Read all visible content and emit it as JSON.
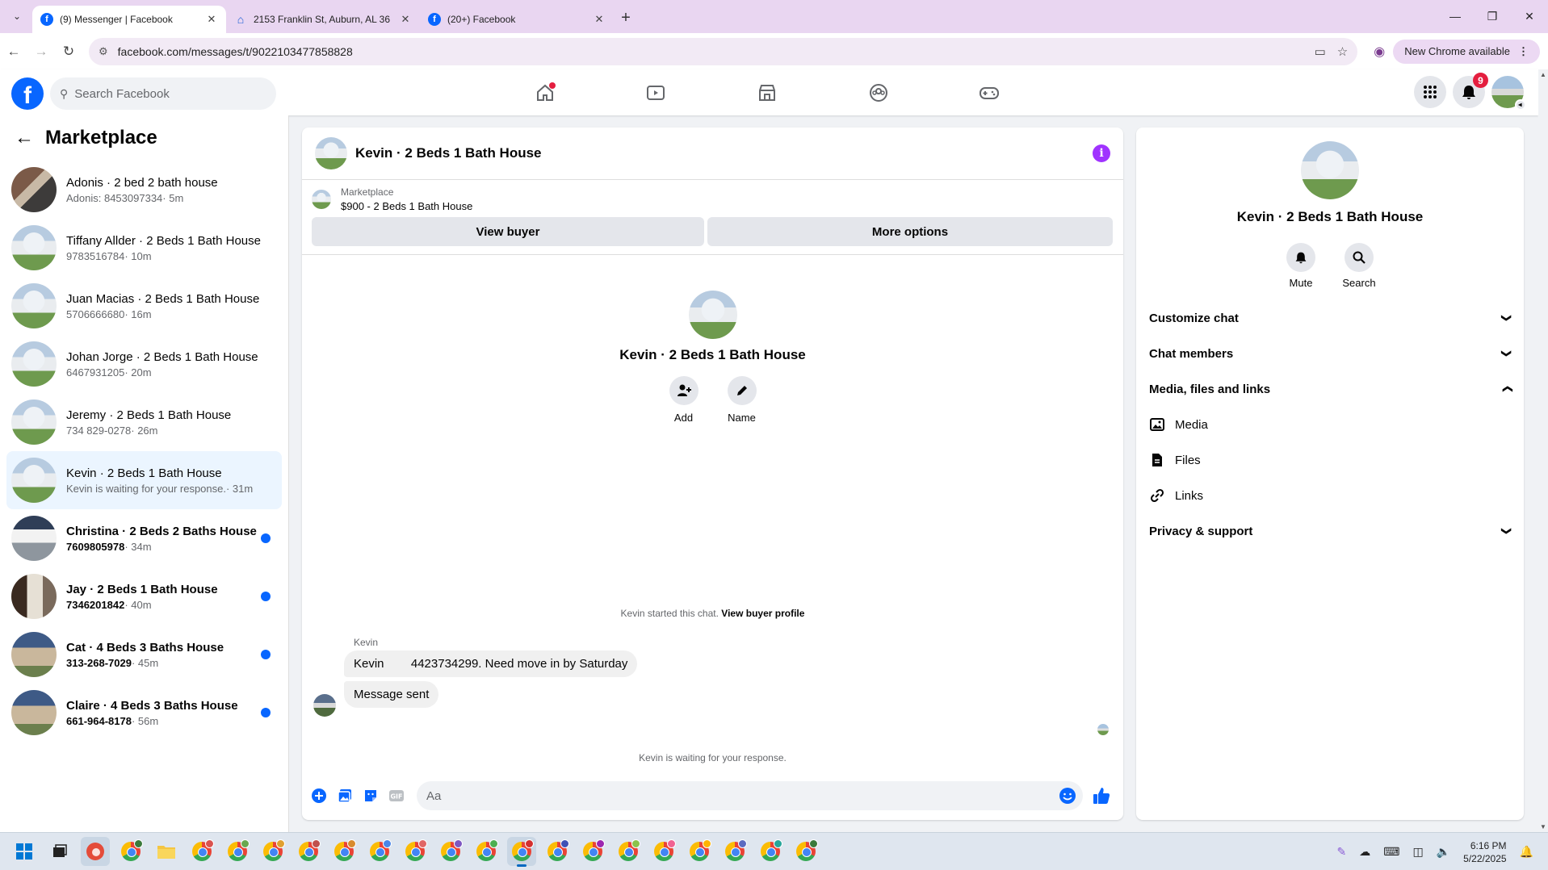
{
  "browser": {
    "tabs": [
      {
        "title": "(9) Messenger | Facebook",
        "icon": "facebook-icon",
        "active": true
      },
      {
        "title": "2153 Franklin St, Auburn, AL 36",
        "icon": "zillow-icon",
        "active": false
      },
      {
        "title": "(20+) Facebook",
        "icon": "facebook-icon",
        "active": false
      }
    ],
    "url": "facebook.com/messages/t/9022103477858828",
    "new_chrome_label": "New Chrome available"
  },
  "fb": {
    "search_placeholder": "Search Facebook",
    "notifications_count": "9",
    "logo_letter": "f"
  },
  "sidebar": {
    "title": "Marketplace",
    "conversations": [
      {
        "name": "Adonis · 2 bed 2 bath house",
        "preview": "Adonis: 8453097334",
        "time": "· 5m",
        "unread": false,
        "thumb": "house2"
      },
      {
        "name": "Tiffany Allder · 2 Beds 1 Bath House",
        "preview": "9783516784",
        "time": "· 10m",
        "unread": false,
        "thumb": "house1"
      },
      {
        "name": "Juan Macias · 2 Beds 1 Bath House",
        "preview": "5706666680",
        "time": "· 16m",
        "unread": false,
        "thumb": "house1"
      },
      {
        "name": "Johan Jorge · 2 Beds 1 Bath House",
        "preview": "6467931205",
        "time": "· 20m",
        "unread": false,
        "thumb": "house1"
      },
      {
        "name": "Jeremy · 2 Beds 1 Bath House",
        "preview": "734 829-0278",
        "time": "· 26m",
        "unread": false,
        "thumb": "house1"
      },
      {
        "name": "Kevin · 2 Beds 1 Bath House",
        "preview": "Kevin is waiting for your response.",
        "time": "· 31m",
        "unread": false,
        "selected": true,
        "thumb": "house1"
      },
      {
        "name": "Christina · 2 Beds 2 Baths House",
        "preview": "7609805978",
        "time": "· 34m",
        "unread": true,
        "thumb": "house3"
      },
      {
        "name": "Jay · 2 Beds 1 Bath House",
        "preview": "7346201842",
        "time": "· 40m",
        "unread": true,
        "thumb": "house4"
      },
      {
        "name": "Cat · 4 Beds 3 Baths House",
        "preview": "313-268-7029",
        "time": "· 45m",
        "unread": true,
        "thumb": "house5"
      },
      {
        "name": "Claire · 4 Beds 3 Baths House",
        "preview": "661-964-8178",
        "time": "· 56m",
        "unread": true,
        "thumb": "house5"
      }
    ]
  },
  "chat": {
    "title": "Kevin · 2 Beds 1 Bath House",
    "marketplace_label": "Marketplace",
    "listing": "$900 - 2 Beds 1 Bath House",
    "view_buyer": "View buyer",
    "more_options": "More options",
    "intro_name": "Kevin · 2 Beds 1 Bath House",
    "add_label": "Add",
    "name_label": "Name",
    "started_text": "Kevin started this chat.",
    "view_buyer_profile": "View buyer profile",
    "sender": "Kevin",
    "message1": "Kevin        4423734299. Need move in by Saturday",
    "message2": "Message sent",
    "waiting": "Kevin is waiting for your response.",
    "composer_placeholder": "Aa"
  },
  "details": {
    "name": "Kevin · 2 Beds 1 Bath House",
    "mute": "Mute",
    "search": "Search",
    "sections": {
      "customize": "Customize chat",
      "members": "Chat members",
      "media_files": "Media, files and links",
      "media": "Media",
      "files": "Files",
      "links": "Links",
      "privacy": "Privacy & support"
    }
  },
  "taskbar": {
    "time": "6:16 PM",
    "date": "5/22/2025"
  },
  "colors": {
    "accent": "#0866ff",
    "info": "#a033ff",
    "unread_dot": "#0866ff"
  }
}
